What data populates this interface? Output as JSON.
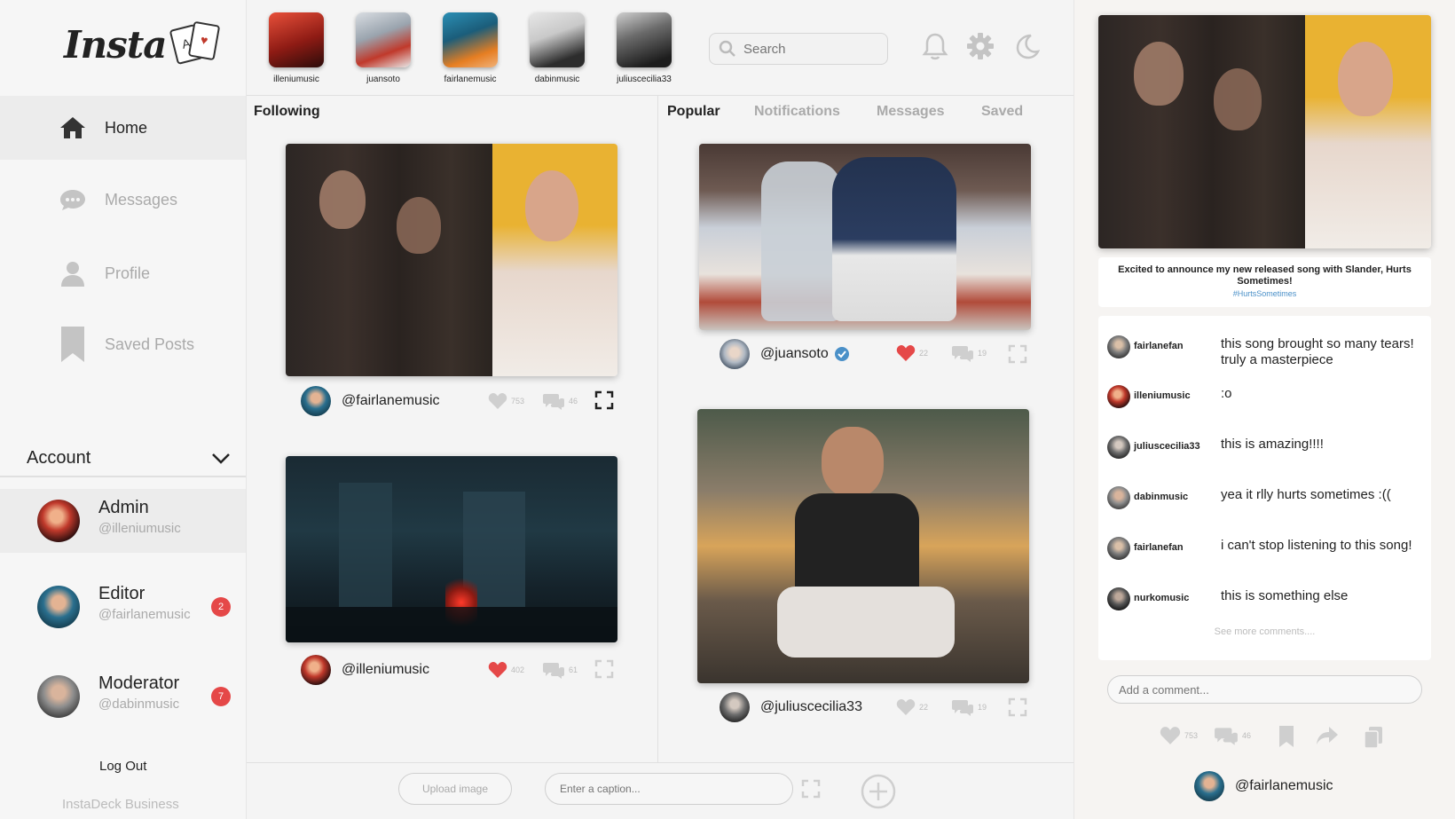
{
  "brand": {
    "logo_text": "Insta",
    "card_glyphs": [
      "A",
      "♥",
      "K"
    ]
  },
  "nav": {
    "items": [
      {
        "label": "Home",
        "icon": "home-icon"
      },
      {
        "label": "Messages",
        "icon": "chat-bubble-icon"
      },
      {
        "label": "Profile",
        "icon": "user-icon"
      },
      {
        "label": "Saved Posts",
        "icon": "bookmark-icon"
      }
    ]
  },
  "account": {
    "title": "Account",
    "users": [
      {
        "role": "Admin",
        "handle": "@illeniumusic",
        "badge": ""
      },
      {
        "role": "Editor",
        "handle": "@fairlanemusic",
        "badge": "2"
      },
      {
        "role": "Moderator",
        "handle": "@dabinmusic",
        "badge": "7"
      }
    ],
    "logout": "Log Out",
    "business": "InstaDeck Business"
  },
  "stories": [
    {
      "name": "illeniumusic"
    },
    {
      "name": "juansoto"
    },
    {
      "name": "fairlanemusic"
    },
    {
      "name": "dabinmusic"
    },
    {
      "name": "juliuscecilia33"
    }
  ],
  "search": {
    "placeholder": "Search"
  },
  "following": {
    "title": "Following",
    "posts": [
      {
        "handle": "@fairlanemusic",
        "likes": "753",
        "comments": "46",
        "liked": false
      },
      {
        "handle": "@illeniumusic",
        "likes": "402",
        "comments": "61",
        "liked": true
      }
    ]
  },
  "tabs": [
    "Popular",
    "Notifications",
    "Messages",
    "Saved"
  ],
  "popular": {
    "posts": [
      {
        "handle": "@juansoto",
        "verified": true,
        "likes": "22",
        "comments": "19",
        "liked": true
      },
      {
        "handle": "@juliuscecilia33",
        "verified": false,
        "likes": "22",
        "comments": "19",
        "liked": false
      }
    ]
  },
  "composer": {
    "upload_label": "Upload image",
    "caption_placeholder": "Enter a caption..."
  },
  "detail": {
    "caption": "Excited to announce my new released song with Slander, Hurts Sometimes!",
    "hashtag": "#HurtsSometimes",
    "comments": [
      {
        "user": "fairlanefan",
        "text": "this song brought so many tears! truly a masterpiece"
      },
      {
        "user": "illeniumusic",
        "text": ":o"
      },
      {
        "user": "juliuscecilia33",
        "text": "this is amazing!!!!"
      },
      {
        "user": "dabinmusic",
        "text": "yea it rlly hurts sometimes :(("
      },
      {
        "user": "fairlanefan",
        "text": "i can't stop listening to this song!"
      },
      {
        "user": "nurkomusic",
        "text": "this is something else"
      }
    ],
    "see_more": "See more comments....",
    "add_comment_placeholder": "Add a comment...",
    "likes": "753",
    "comments_count": "46",
    "author": "@fairlanemusic"
  },
  "colors": {
    "accent_red": "#e54848",
    "verified_blue": "#4a90c8",
    "muted": "#aaaaaa"
  }
}
